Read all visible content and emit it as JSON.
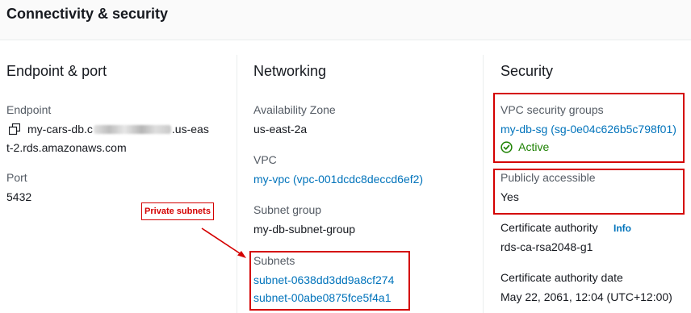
{
  "header": {
    "title": "Connectivity & security"
  },
  "endpoint_port": {
    "title": "Endpoint & port",
    "endpoint_label": "Endpoint",
    "endpoint_prefix": "my-cars-db.c",
    "endpoint_suffix": ".us-eas",
    "endpoint_line2": "t-2.rds.amazonaws.com",
    "copy_icon": "copy-icon",
    "port_label": "Port",
    "port_value": "5432"
  },
  "networking": {
    "title": "Networking",
    "az_label": "Availability Zone",
    "az_value": "us-east-2a",
    "vpc_label": "VPC",
    "vpc_value": "my-vpc (vpc-001dcdc8deccd6ef2)",
    "subnet_group_label": "Subnet group",
    "subnet_group_value": "my-db-subnet-group",
    "subnets_label": "Subnets",
    "subnets": [
      "subnet-0638dd3dd9a8cf274",
      "subnet-00abe0875fce5f4a1"
    ]
  },
  "security": {
    "title": "Security",
    "sg_label": "VPC security groups",
    "sg_value": "my-db-sg (sg-0e04c626b5c798f01)",
    "sg_status": "Active",
    "status_icon": "check-circle-icon",
    "public_label": "Publicly accessible",
    "public_value": "Yes",
    "ca_label": "Certificate authority",
    "ca_info": "Info",
    "ca_value": "rds-ca-rsa2048-g1",
    "ca_date_label": "Certificate authority date",
    "ca_date_value": "May 22, 2061, 12:04 (UTC+12:00)"
  },
  "annotation": {
    "callout_text": "Private subnets"
  },
  "colors": {
    "link": "#0073bb",
    "success": "#1d8102",
    "annotation": "#d40000",
    "label": "#545b64",
    "text": "#16191f"
  }
}
